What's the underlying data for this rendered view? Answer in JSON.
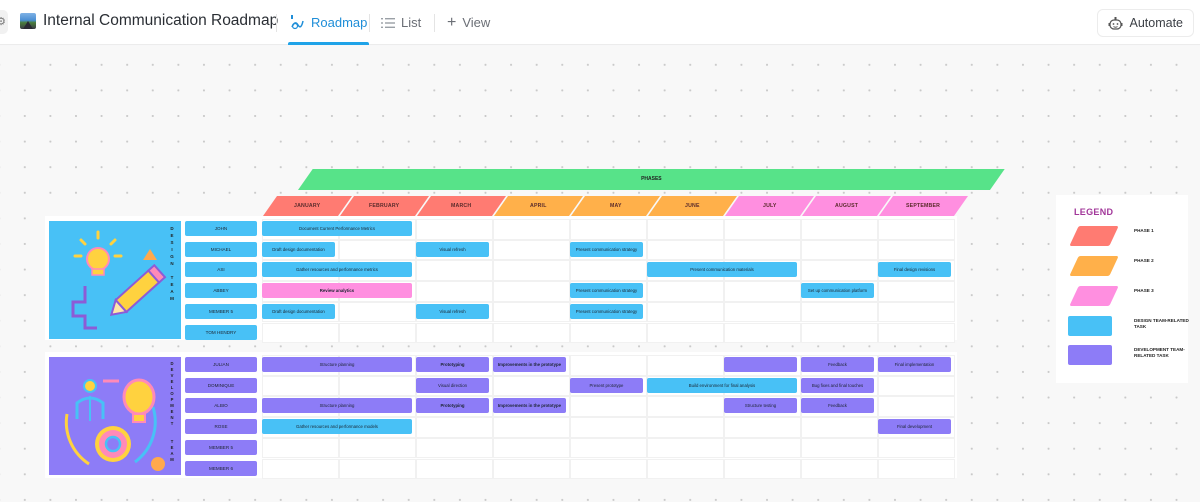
{
  "header": {
    "title": "Internal Communication Roadmap",
    "title_icon": "landscape-image-icon",
    "tabs": [
      {
        "label": "Roadmap",
        "icon": "roadmap-icon",
        "active": true
      },
      {
        "label": "List",
        "icon": "list-icon",
        "active": false
      },
      {
        "label": "View",
        "icon": "plus-icon",
        "active": false
      }
    ],
    "automate_label": "Automate",
    "automate_icon": "robot-icon"
  },
  "roadmap": {
    "phases_label": "PHASES",
    "months": [
      {
        "label": "JANUARY",
        "phase": 1
      },
      {
        "label": "FEBRUARY",
        "phase": 1
      },
      {
        "label": "MARCH",
        "phase": 1
      },
      {
        "label": "APRIL",
        "phase": 2
      },
      {
        "label": "MAY",
        "phase": 2
      },
      {
        "label": "JUNE",
        "phase": 2
      },
      {
        "label": "JULY",
        "phase": 3
      },
      {
        "label": "AUGUST",
        "phase": 3
      },
      {
        "label": "SEPTEMBER",
        "phase": 3
      }
    ],
    "teams": [
      {
        "name": "DESIGN TEAM",
        "vertical_label": [
          "D",
          "E",
          "S",
          "I",
          "G",
          "N",
          " ",
          "T",
          "E",
          "A",
          "M"
        ],
        "members": [
          "JOHN",
          "MICHAEL",
          "ASI",
          "ABBEY",
          "MEMBER 5",
          "TOM HENDRY"
        ],
        "tasks": [
          {
            "row": 0,
            "start": 0,
            "span": 2,
            "label": "Document Current Performance Metrics",
            "type": "design"
          },
          {
            "row": 1,
            "start": 0,
            "span": 1,
            "label": "Draft design documentation",
            "type": "design"
          },
          {
            "row": 1,
            "start": 2,
            "span": 1,
            "label": "Visual refresh",
            "type": "design"
          },
          {
            "row": 1,
            "start": 4,
            "span": 1,
            "label": "Present communication strategy",
            "type": "design"
          },
          {
            "row": 2,
            "start": 0,
            "span": 2,
            "label": "Gather resources and performance metrics",
            "type": "design"
          },
          {
            "row": 2,
            "start": 5,
            "span": 2,
            "label": "Present communication materials",
            "type": "design"
          },
          {
            "row": 2,
            "start": 8,
            "span": 1,
            "label": "Final design revisions",
            "type": "design"
          },
          {
            "row": 3,
            "start": 0,
            "span": 2,
            "label": "Review analytics",
            "type": "pink",
            "bold": true
          },
          {
            "row": 3,
            "start": 4,
            "span": 1,
            "label": "Present communication strategy",
            "type": "design"
          },
          {
            "row": 3,
            "start": 7,
            "span": 1,
            "label": "Set up communication platform",
            "type": "design"
          },
          {
            "row": 4,
            "start": 0,
            "span": 1,
            "label": "Draft design documentation",
            "type": "design"
          },
          {
            "row": 4,
            "start": 2,
            "span": 1,
            "label": "Visual refresh",
            "type": "design"
          },
          {
            "row": 4,
            "start": 4,
            "span": 1,
            "label": "Present communication strategy",
            "type": "design"
          }
        ]
      },
      {
        "name": "DEVELOPMENT TEAM",
        "vertical_label": [
          "D",
          "E",
          "V",
          "E",
          "L",
          "O",
          "P",
          "M",
          "E",
          "N",
          "T",
          " ",
          "T",
          "E",
          "A",
          "M"
        ],
        "members": [
          "JULIAN",
          "DOMINIQUE",
          "ALBIO",
          "ROSE",
          "MEMBER 5",
          "MEMBER 6"
        ],
        "tasks": [
          {
            "row": 0,
            "start": 0,
            "span": 2,
            "label": "Structure planning",
            "type": "dev"
          },
          {
            "row": 0,
            "start": 2,
            "span": 1,
            "label": "Prototyping",
            "type": "dev",
            "bold": true
          },
          {
            "row": 0,
            "start": 3,
            "span": 1,
            "label": "Improvements in the prototype",
            "type": "dev",
            "bold": true
          },
          {
            "row": 0,
            "start": 6,
            "span": 1,
            "label": "",
            "type": "dev"
          },
          {
            "row": 0,
            "start": 7,
            "span": 1,
            "label": "Feedback",
            "type": "dev"
          },
          {
            "row": 0,
            "start": 8,
            "span": 1,
            "label": "Final implementation",
            "type": "dev"
          },
          {
            "row": 1,
            "start": 2,
            "span": 1,
            "label": "Visual direction",
            "type": "dev"
          },
          {
            "row": 1,
            "start": 4,
            "span": 1,
            "label": "Present prototype",
            "type": "dev"
          },
          {
            "row": 1,
            "start": 5,
            "span": 2,
            "label": "Build environment for final analysis",
            "type": "design"
          },
          {
            "row": 1,
            "start": 7,
            "span": 1,
            "label": "Bug fixes and final touches",
            "type": "dev"
          },
          {
            "row": 2,
            "start": 0,
            "span": 2,
            "label": "Structure planning",
            "type": "dev"
          },
          {
            "row": 2,
            "start": 2,
            "span": 1,
            "label": "Prototyping",
            "type": "dev",
            "bold": true
          },
          {
            "row": 2,
            "start": 3,
            "span": 1,
            "label": "Improvements in the prototype",
            "type": "dev",
            "bold": true
          },
          {
            "row": 2,
            "start": 6,
            "span": 1,
            "label": "Structure testing",
            "type": "dev"
          },
          {
            "row": 2,
            "start": 7,
            "span": 1,
            "label": "Feedback",
            "type": "dev"
          },
          {
            "row": 3,
            "start": 0,
            "span": 2,
            "label": "Gather resources and performance models",
            "type": "design"
          },
          {
            "row": 3,
            "start": 8,
            "span": 1,
            "label": "Final development",
            "type": "dev"
          }
        ]
      }
    ]
  },
  "legend": {
    "title": "LEGEND",
    "items": [
      {
        "label": "PHASE 1",
        "color": "#ff7b72",
        "shape": "parallelogram"
      },
      {
        "label": "PHASE 2",
        "color": "#ffb04a",
        "shape": "parallelogram"
      },
      {
        "label": "PHASE 3",
        "color": "#ff8fe0",
        "shape": "parallelogram"
      },
      {
        "label": "DESIGN TEAM-RELATED TASK",
        "color": "#48c1f6",
        "shape": "rectangle"
      },
      {
        "label": "DEVELOPMENT TEAM-RELATED TASK",
        "color": "#8d7cf7",
        "shape": "rectangle"
      }
    ]
  },
  "colors": {
    "phases_bar": "#57e389",
    "phase1": "#ff7b72",
    "phase2": "#ffb04a",
    "phase3": "#ff8fe0",
    "design": "#48c1f6",
    "dev": "#8d7cf7",
    "accent": "#1fa3e8",
    "legend_title": "#a2379a"
  }
}
